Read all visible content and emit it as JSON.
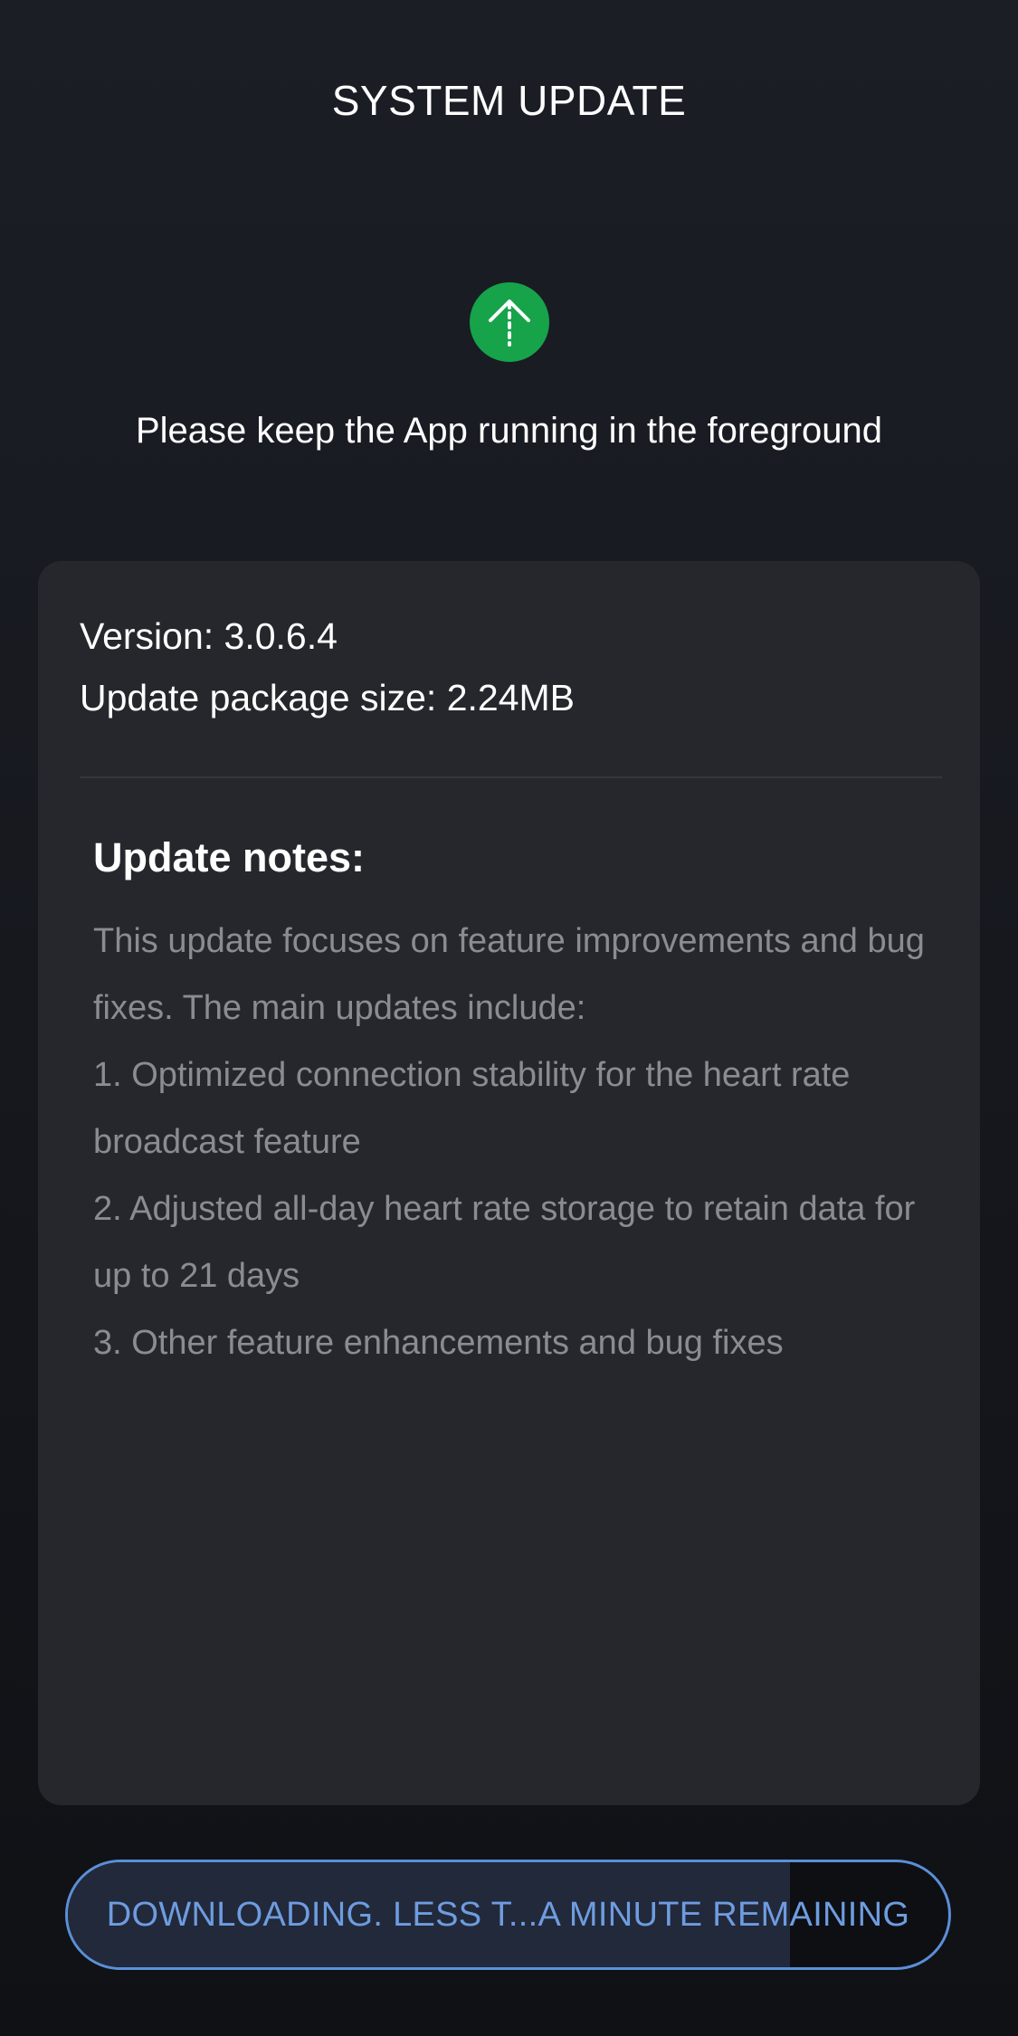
{
  "header": {
    "title": "SYSTEM UPDATE"
  },
  "status": {
    "icon": "upload-arrow-icon",
    "icon_color": "#16a34a",
    "notice": "Please keep the App running in the foreground"
  },
  "update_info": {
    "version_text": "Version: 3.0.6.4",
    "package_size_text": "Update package size: 2.24MB"
  },
  "notes": {
    "heading": "Update notes:",
    "lines": [
      "This update focuses on feature improvements and bug fixes. The main updates include:",
      "1. Optimized connection stability for the heart rate broadcast feature",
      "2. Adjusted all-day heart rate storage to retain data for up to 21 days",
      "3. Other feature enhancements and bug fixes"
    ]
  },
  "download": {
    "label": "DOWNLOADING. LESS T...A MINUTE REMAINING",
    "progress": 0.82,
    "accent_color": "#5b8fd8"
  }
}
